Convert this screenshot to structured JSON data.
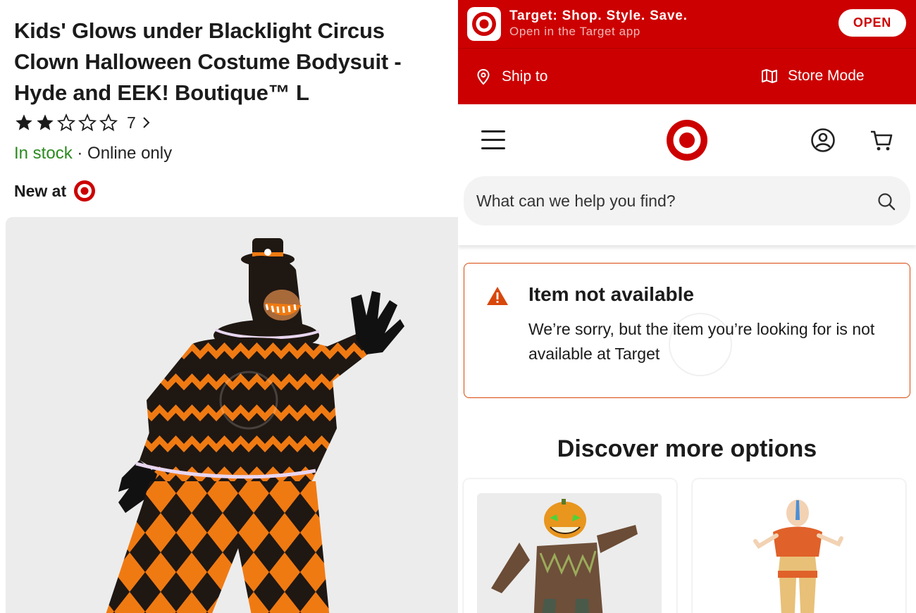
{
  "product": {
    "title": "Kids' Glows under Blacklight Circus Clown Halloween Costume Bodysuit - Hyde and EEK! Boutique™ L",
    "rating": 2,
    "rating_max": 5,
    "review_count": "7",
    "stock_status": "In stock",
    "availability_note": " · Online only",
    "new_at_label": "New at"
  },
  "app_banner": {
    "title": "Target: Shop. Style. Save.",
    "subtitle": "Open in the Target app",
    "open_label": "OPEN"
  },
  "location_bar": {
    "ship_to_label": "Ship to",
    "store_mode_label": "Store Mode"
  },
  "search": {
    "placeholder": "What can we help you find?"
  },
  "alert": {
    "title": "Item not available",
    "message": "We’re sorry, but the item you’re looking for is not available at Target"
  },
  "discover": {
    "heading": "Discover more options",
    "cards": [
      {
        "image_name": "pumpkin-head-costume-image"
      },
      {
        "image_name": "airbender-costume-image"
      }
    ]
  },
  "colors": {
    "brand_red": "#cc0000",
    "in_stock_green": "#2b8a1f",
    "alert_border": "#d8470c",
    "costume_orange": "#f07a12"
  },
  "icons": [
    "star-icon",
    "chevron-right-icon",
    "bullseye-logo-icon",
    "location-pin-icon",
    "map-icon",
    "hamburger-menu-icon",
    "account-icon",
    "cart-icon",
    "search-icon",
    "warning-icon"
  ]
}
